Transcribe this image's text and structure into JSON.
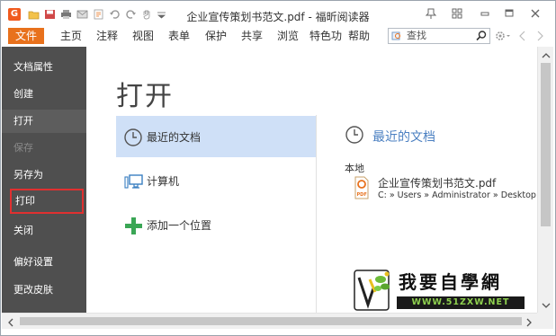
{
  "window": {
    "title": "企业宣传策划书范文.pdf - 福昕阅读器",
    "app_icon_letter": "G",
    "quick_access_icons": [
      "open-folder-icon",
      "save-icon",
      "print-icon",
      "email-icon",
      "new-icon",
      "undo-icon",
      "redo-icon",
      "hand-tool-icon",
      "customize-dropdown-icon"
    ],
    "title_buttons": [
      "pin-icon",
      "layout-grid-icon",
      "minimize-icon",
      "restore-icon",
      "close-icon"
    ]
  },
  "menu": {
    "file_label": "文件",
    "items": [
      "主页",
      "注释",
      "视图",
      "表单",
      "保护",
      "共享",
      "浏览",
      "特色功",
      "帮助"
    ],
    "search_placeholder": "查找",
    "right_icons": [
      "settings-icon",
      "nav-back-icon",
      "nav-forward-icon"
    ]
  },
  "sidebar": {
    "items": [
      {
        "label": "文档属性",
        "state": "normal"
      },
      {
        "label": "创建",
        "state": "normal"
      },
      {
        "label": "打开",
        "state": "active"
      },
      {
        "label": "保存",
        "state": "disabled"
      },
      {
        "label": "另存为",
        "state": "normal"
      },
      {
        "label": "打印",
        "state": "highlighted"
      },
      {
        "label": "关闭",
        "state": "normal"
      },
      {
        "label": "偏好设置",
        "state": "normal"
      },
      {
        "label": "更改皮肤",
        "state": "normal"
      }
    ]
  },
  "main": {
    "heading": "打开",
    "locations": [
      {
        "label": "最近的文档",
        "icon": "clock-icon",
        "selected": true
      },
      {
        "label": "计算机",
        "icon": "computer-icon",
        "selected": false
      },
      {
        "label": "添加一个位置",
        "icon": "add-plus-icon",
        "selected": false
      }
    ],
    "recent": {
      "title": "最近的文档",
      "group_label": "本地",
      "files": [
        {
          "name": "企业宣传策划书范文.pdf",
          "path": "C: » Users » Administrator » Desktop",
          "icon": "pdf-file-icon"
        }
      ]
    }
  },
  "watermark": {
    "text": "我要自學網",
    "url": "WWW.51ZXW.NET"
  },
  "colors": {
    "accent_orange": "#e8711c",
    "sidebar_bg": "#4f4f4f",
    "selected_bg": "#cfe0f7",
    "link_blue": "#4a7fc1",
    "highlight_red": "#e03030",
    "add_green": "#3aa655"
  }
}
